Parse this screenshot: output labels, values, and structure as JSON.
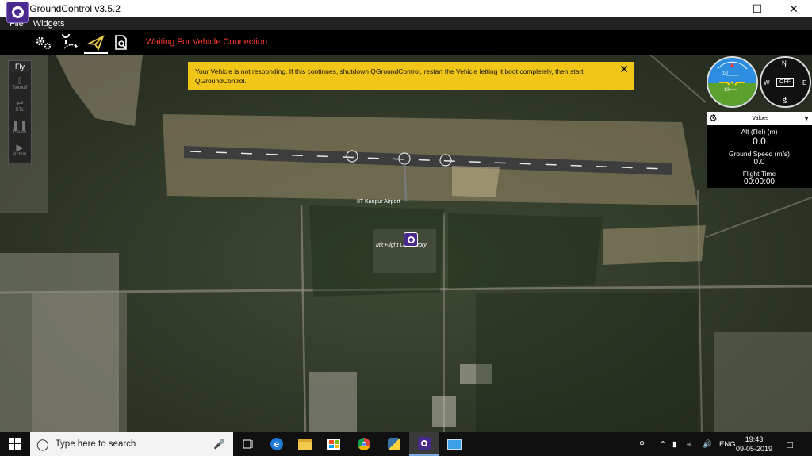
{
  "window": {
    "title": "QGroundControl v3.5.2"
  },
  "menu": {
    "file": "File",
    "widgets": "Widgets"
  },
  "toolbar": {
    "status": "Waiting For Vehicle Connection"
  },
  "fly_panel": {
    "title": "Fly",
    "items": [
      {
        "label": "Takeoff",
        "icon": "takeoff-icon"
      },
      {
        "label": "RTL",
        "icon": "rtl-icon"
      },
      {
        "label": "Pause",
        "icon": "pause-icon"
      },
      {
        "label": "Action",
        "icon": "action-icon"
      }
    ]
  },
  "warning": {
    "message": "Your Vehicle is not responding. If this continues, shutdown QGroundControl, restart the Vehicle letting it boot completely, then start QGroundControl.",
    "bg_color": "#f2c618"
  },
  "map": {
    "labels": {
      "airport": "IIT Kanpur Airport",
      "observatory": "IItk Flight Laboratory"
    }
  },
  "compass": {
    "n": "N",
    "s": "S",
    "e": "E",
    "w": "W",
    "mode": "OFF"
  },
  "attitude": {
    "t10": "10",
    "b10": "-10"
  },
  "values_widget": {
    "header": "Values",
    "alt_label": "Alt (Rel) (m)",
    "alt_value": "0.0",
    "gs_label": "Ground Speed (m/s)",
    "gs_value": "0.0",
    "ft_label": "Flight Time",
    "ft_value": "00:00:00"
  },
  "taskbar": {
    "search_placeholder": "Type here to search",
    "lang": "ENG",
    "time": "19:43",
    "date": "09-05-2019"
  }
}
